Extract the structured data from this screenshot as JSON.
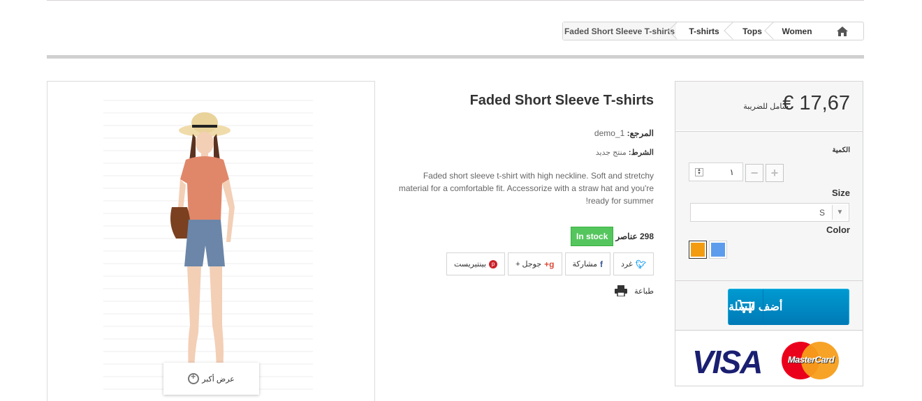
{
  "breadcrumb": {
    "home_icon": "home-icon",
    "items": [
      "Women",
      "Tops",
      "T-shirts"
    ],
    "current": "Faded Short Sleeve T-shirts"
  },
  "product": {
    "title": "Faded Short Sleeve T-shirts",
    "reference_label": "المرجع:",
    "reference_value": "demo_1",
    "condition_label": "الشرط:",
    "condition_value": "منتج جديد",
    "description": "Faded short sleeve t-shirt with high neckline. Soft and stretchy material for a comfortable fit. Accessorize with a straw hat and you're ready for summer!",
    "stock_quantity": "298",
    "stock_unit": "عناصر",
    "stock_status": "In stock"
  },
  "image": {
    "zoom_label": "عرض أكبر",
    "zoom_icon": "zoom-in-icon"
  },
  "social": {
    "tweet": "غرد",
    "share": "مشاركة",
    "google": "جوجل +",
    "pinterest": "بينتيريست"
  },
  "print_label": "طباعة",
  "buy": {
    "price": "€ 17,67",
    "tax_label": "شامل للضريبة",
    "quantity_label": "الكمية",
    "quantity_value": "١",
    "size_label": "Size",
    "size_value": "S",
    "color_label": "Color",
    "colors": [
      "#f39c11",
      "#5d9cec"
    ],
    "add_to_cart": "أضف للسلة"
  },
  "payment": {
    "visa": "VISA",
    "mastercard": "MasterCard"
  }
}
